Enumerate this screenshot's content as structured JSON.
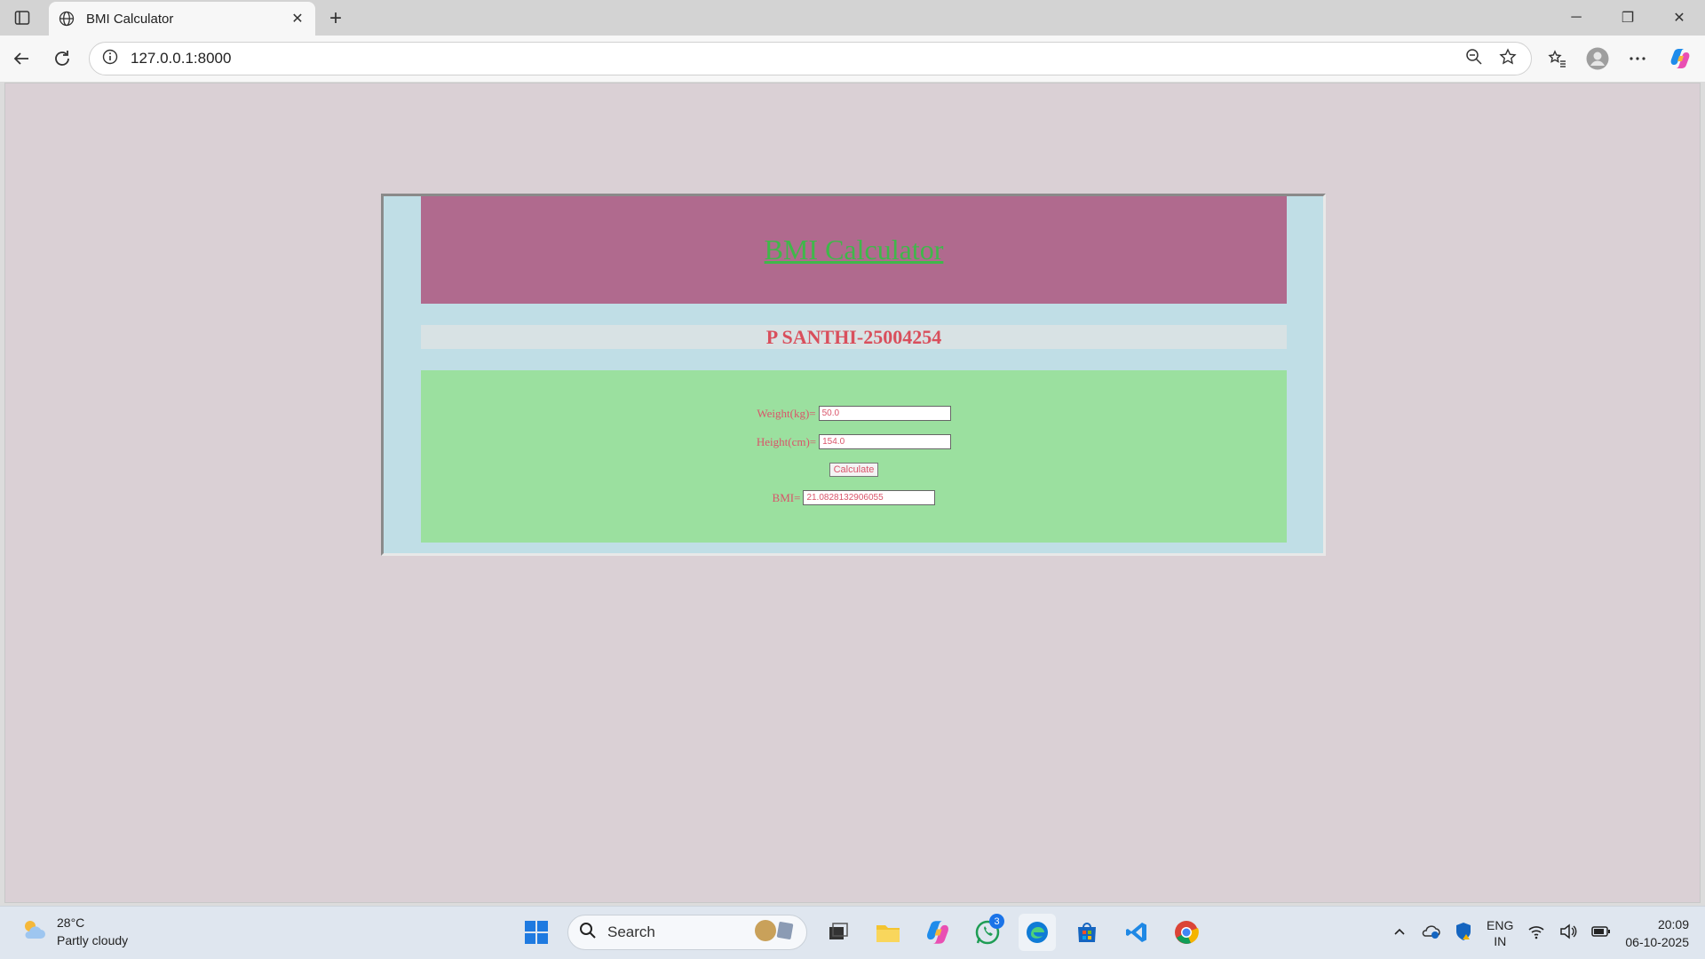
{
  "browser": {
    "tab_title": "BMI Calculator",
    "url": "127.0.0.1:8000"
  },
  "page": {
    "header_title": "BMI Calculator",
    "student": "P SANTHI-25004254",
    "form": {
      "weight_label": "Weight(kg)=",
      "weight_value": "50.0",
      "height_label": "Height(cm)=",
      "height_value": "154.0",
      "calculate_label": "Calculate",
      "bmi_label": "BMI=",
      "bmi_value": "21.0828132906055"
    }
  },
  "taskbar": {
    "weather_temp": "28°C",
    "weather_desc": "Partly cloudy",
    "search_label": "Search",
    "whatsapp_badge": "3",
    "lang_line1": "ENG",
    "lang_line2": "IN",
    "time": "20:09",
    "date": "06-10-2025"
  },
  "colors": {
    "header_bg": "#b06a8e",
    "title_green": "#3fb84a",
    "form_bg": "#9be09f",
    "text_red": "#d9546a",
    "outer_bg": "#c0dee6",
    "page_bg": "#dad0d5"
  }
}
